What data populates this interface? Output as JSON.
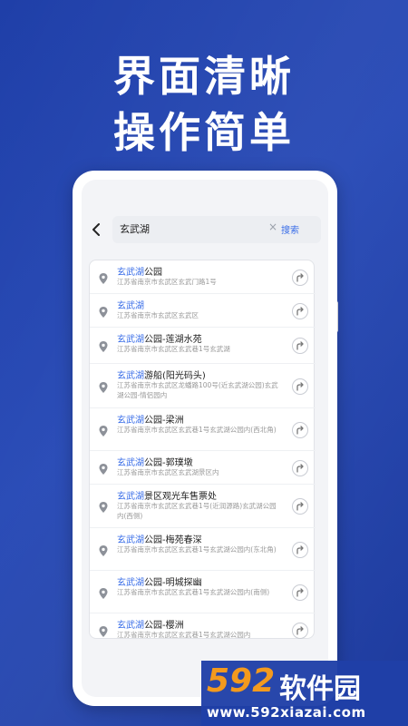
{
  "headline": {
    "line1": "界面清晰",
    "line2": "操作简单"
  },
  "search": {
    "query": "玄武湖",
    "clear_icon": "close-icon",
    "button_label": "搜索",
    "back_icon": "chevron-left-icon"
  },
  "results": [
    {
      "title_highlight": "玄武湖",
      "title_rest": "公园",
      "address": "江苏省南京市玄武区玄武门路1号"
    },
    {
      "title_highlight": "玄武湖",
      "title_rest": "",
      "address": "江苏省南京市玄武区玄武区"
    },
    {
      "title_highlight": "玄武湖",
      "title_rest": "公园-莲湖水苑",
      "address": "江苏省南京市玄武区玄武巷1号玄武湖"
    },
    {
      "title_highlight": "玄武湖",
      "title_rest": "游船(阳光码头)",
      "address": "江苏省南京市玄武区龙蟠路100号(近玄武湖公园)玄武湖公园-情侣园内"
    },
    {
      "title_highlight": "玄武湖",
      "title_rest": "公园-梁洲",
      "address": "江苏省南京市玄武区玄武巷1号玄武湖公园内(西北角)"
    },
    {
      "title_highlight": "玄武湖",
      "title_rest": "公园-郭璞墩",
      "address": "江苏省南京市玄武区玄武湖景区内"
    },
    {
      "title_highlight": "玄武湖",
      "title_rest": "景区观光车售票处",
      "address": "江苏省南京市玄武区玄武巷1号(近润源路)玄武湖公园内(西侧)"
    },
    {
      "title_highlight": "玄武湖",
      "title_rest": "公园-梅苑春深",
      "address": "江苏省南京市玄武区玄武巷1号玄武湖公园内(东北角)"
    },
    {
      "title_highlight": "玄武湖",
      "title_rest": "公园-明城探幽",
      "address": "江苏省南京市玄武区玄武巷1号玄武湖公园内(南侧)"
    },
    {
      "title_highlight": "玄武湖",
      "title_rest": "公园-樱洲",
      "address": "江苏省南京市玄武区玄武巷1号玄武湖公园内"
    }
  ],
  "watermark": {
    "number": "592",
    "name": "软件园",
    "url": "www.592xiazai.com"
  },
  "colors": {
    "background": "#2447b5",
    "highlight": "#3a6ee8",
    "watermark_number": "#f39a1e"
  }
}
